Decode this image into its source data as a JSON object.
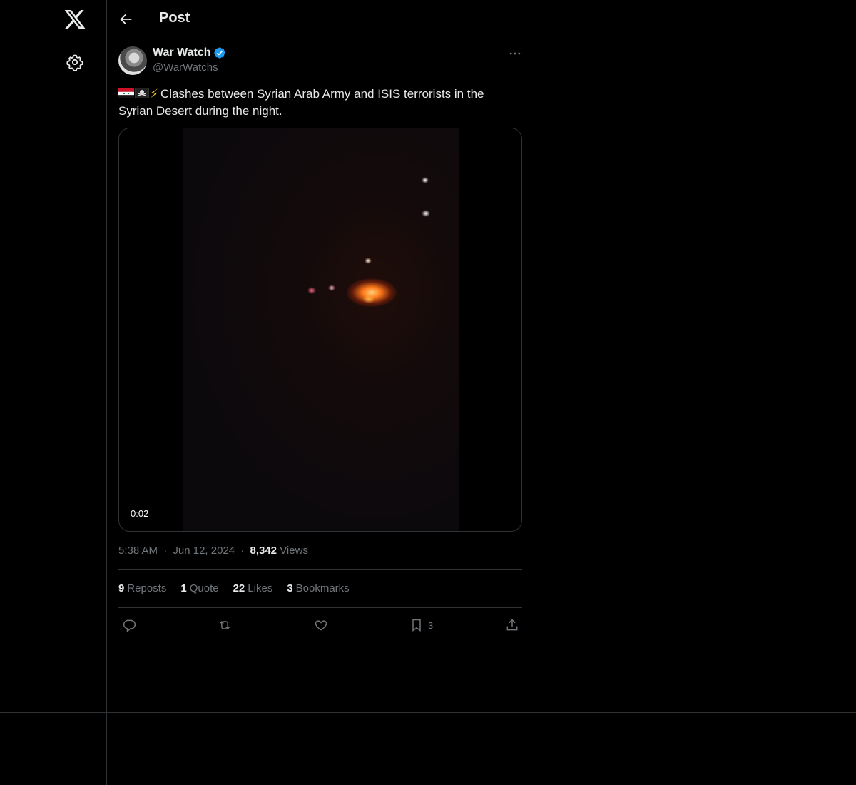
{
  "header": {
    "title": "Post"
  },
  "author": {
    "name": "War Watch",
    "handle": "@WarWatchs"
  },
  "post": {
    "text": "Clashes between Syrian Arab Army and ISIS terrorists in the Syrian Desert during the night.",
    "emoji_bolt": "⚡"
  },
  "media": {
    "duration": "0:02"
  },
  "meta": {
    "time": "5:38 AM",
    "separator": "·",
    "date": "Jun 12, 2024",
    "views_count": "8,342",
    "views_label": "Views"
  },
  "stats": {
    "reposts_count": "9",
    "reposts_label": "Reposts",
    "quotes_count": "1",
    "quotes_label": "Quote",
    "likes_count": "22",
    "likes_label": "Likes",
    "bookmarks_count": "3",
    "bookmarks_label": "Bookmarks"
  },
  "actions": {
    "bookmark_count": "3"
  },
  "icons": [
    "x-logo-icon",
    "settings-icon",
    "back-arrow-icon",
    "verified-icon",
    "more-icon",
    "syria-flag-icon",
    "pirate-flag-icon",
    "reply-icon",
    "repost-icon",
    "like-icon",
    "bookmark-icon",
    "share-icon"
  ],
  "colors": {
    "background": "#000000",
    "text": "#e7e9ea",
    "muted": "#71767b",
    "border": "#2f3336",
    "verified": "#1d9bf0"
  }
}
